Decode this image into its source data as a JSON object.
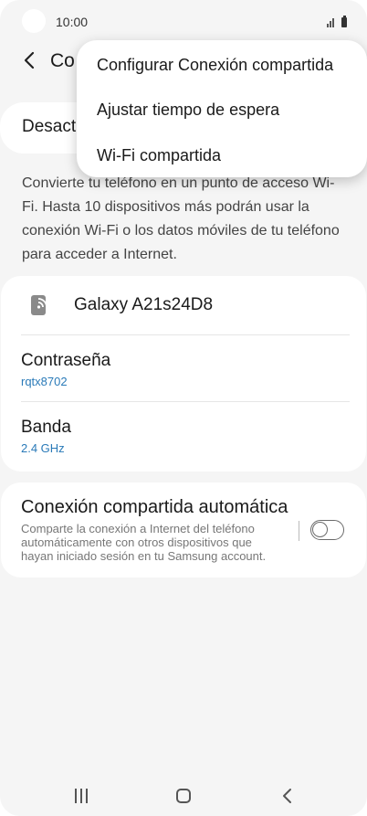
{
  "status_bar": {
    "time": "10:00"
  },
  "header": {
    "title_visible": "Co"
  },
  "toggle_card": {
    "label": "Desact"
  },
  "description": "Convierte tu teléfono en un punto de acceso Wi-Fi. Hasta 10 dispositivos más podrán usar la conexión Wi-Fi o los datos móviles de tu teléfono para acceder a Internet.",
  "network": {
    "hotspot_name": "Galaxy A21s24D8",
    "password_label": "Contraseña",
    "password_value": "rqtx8702",
    "band_label": "Banda",
    "band_value": "2.4 GHz"
  },
  "auto_hotspot": {
    "title": "Conexión compartida automática",
    "description": "Comparte la conexión a Internet del teléfono automáticamente con otros dispositivos que hayan iniciado sesión en tu Samsung account.",
    "enabled": false
  },
  "popup_menu": {
    "items": [
      {
        "label": "Configurar Conexión compartida"
      },
      {
        "label": "Ajustar tiempo de espera"
      },
      {
        "label": "Wi-Fi compartida"
      }
    ]
  },
  "icons": {
    "back": "chevron-left-icon",
    "hotspot": "mobile-hotspot-icon",
    "nav_recents": "recents-icon",
    "nav_home": "home-icon",
    "nav_back": "nav-back-icon"
  },
  "colors": {
    "accent_value": "#2a7ab8",
    "background": "#f5f5f5",
    "card": "#ffffff"
  }
}
